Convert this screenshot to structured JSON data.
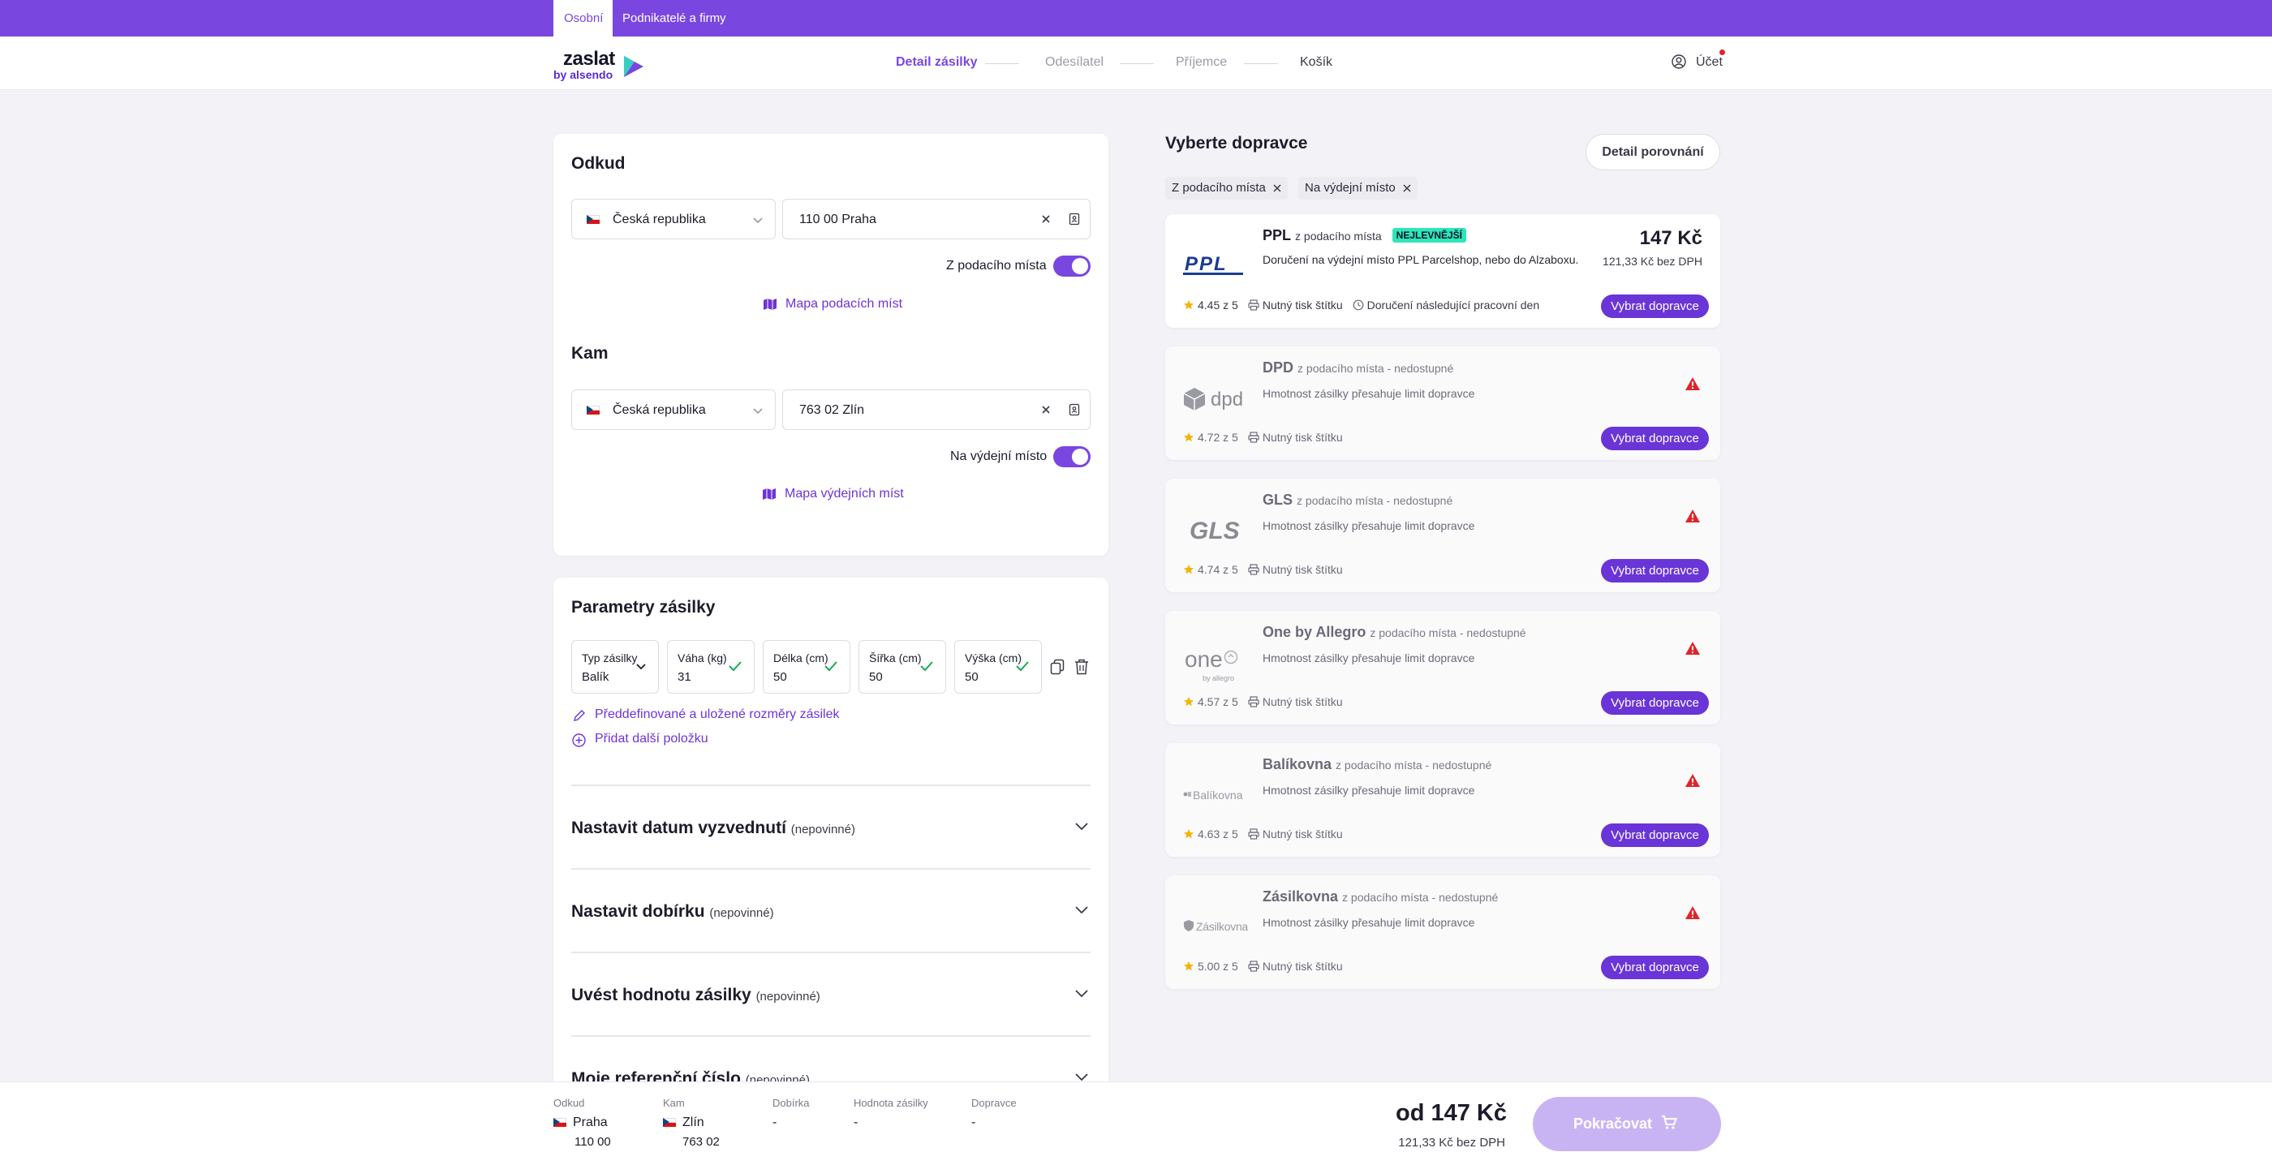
{
  "topbar": {
    "segments": [
      "Osobní",
      "Podnikatelé a firmy"
    ]
  },
  "logo": {
    "word": "zaslat",
    "by": "by alsendo"
  },
  "steps": [
    "Detail zásilky",
    "Odesílatel",
    "Příjemce",
    "Košík"
  ],
  "account": {
    "label": "Účet"
  },
  "from": {
    "title": "Odkud",
    "country": "Česká republika",
    "address": "110 00 Praha",
    "toggle_label": "Z podacího místa",
    "map_link": "Mapa podacích míst"
  },
  "to": {
    "title": "Kam",
    "country": "Česká republika",
    "address": "763 02 Zlín",
    "toggle_label": "Na výdejní místo",
    "map_link": "Mapa výdejních míst"
  },
  "params": {
    "title": "Parametry zásilky",
    "fields": [
      {
        "label": "Typ zásilky",
        "value": "Balík"
      },
      {
        "label": "Váha (kg)",
        "value": "31"
      },
      {
        "label": "Délka (cm)",
        "value": "50"
      },
      {
        "label": "Šířka (cm)",
        "value": "50"
      },
      {
        "label": "Výška (cm)",
        "value": "50"
      }
    ],
    "predefined_link": "Předdefinované a uložené rozměry zásilek",
    "add_link": "Přidat další položku"
  },
  "accordions": [
    {
      "title": "Nastavit datum vyzvednutí",
      "note": "(nepovinné)"
    },
    {
      "title": "Nastavit dobírku",
      "note": "(nepovinné)"
    },
    {
      "title": "Uvést hodnotu zásilky",
      "note": "(nepovinné)"
    },
    {
      "title": "Moje referenční číslo",
      "note": "(nepovinné)"
    }
  ],
  "carriers_panel": {
    "title": "Vyberte dopravce",
    "compare_button": "Detail porovnání",
    "filters": [
      "Z podacího místa",
      "Na výdejní místo"
    ]
  },
  "carriers": [
    {
      "name": "PPL",
      "sub": "z podacího místa",
      "badge": "NEJLEVNĚJŠÍ",
      "desc": "Doručení na výdejní místo PPL Parcelshop, nebo do Alzaboxu.",
      "rating": "4.45 z 5",
      "print": "Nutný tisk štítku",
      "delivery": "Doručení následující pracovní den",
      "price": "147 Kč",
      "price_sub": "121,33 Kč bez DPH",
      "button": "Vybrat dopravce",
      "logo_text": "PPL"
    },
    {
      "name": "DPD",
      "sub": "z podacího místa - nedostupné",
      "desc": "Hmotnost zásilky přesahuje limit dopravce",
      "rating": "4.72 z 5",
      "print": "Nutný tisk štítku",
      "button": "Vybrat dopravce",
      "logo_text": "dpd"
    },
    {
      "name": "GLS",
      "sub": "z podacího místa - nedostupné",
      "desc": "Hmotnost zásilky přesahuje limit dopravce",
      "rating": "4.74 z 5",
      "print": "Nutný tisk štítku",
      "button": "Vybrat dopravce",
      "logo_text": "GLS"
    },
    {
      "name": "One by Allegro",
      "sub": "z podacího místa - nedostupné",
      "desc": "Hmotnost zásilky přesahuje limit dopravce",
      "rating": "4.57 z 5",
      "print": "Nutný tisk štítku",
      "button": "Vybrat dopravce",
      "logo_text": "one",
      "logo_sub": "by allegro"
    },
    {
      "name": "Balíkovna",
      "sub": "z podacího místa - nedostupné",
      "desc": "Hmotnost zásilky přesahuje limit dopravce",
      "rating": "4.63 z 5",
      "print": "Nutný tisk štítku",
      "button": "Vybrat dopravce",
      "logo_text": "Balíkovna"
    },
    {
      "name": "Zásilkovna",
      "sub": "z podacího místa - nedostupné",
      "desc": "Hmotnost zásilky přesahuje limit dopravce",
      "rating": "5.00 z 5",
      "print": "Nutný tisk štítku",
      "button": "Vybrat dopravce",
      "logo_text": "Zásilkovna"
    }
  ],
  "footer": {
    "from_label": "Odkud",
    "from_city": "Praha",
    "from_zip": "110 00",
    "to_label": "Kam",
    "to_city": "Zlín",
    "to_zip": "763 02",
    "cod_label": "Dobírka",
    "cod_value": "-",
    "value_label": "Hodnota zásilky",
    "value_value": "-",
    "carrier_label": "Dopravce",
    "carrier_value": "-",
    "price": "od 147 Kč",
    "price_sub": "121,33 Kč bez DPH",
    "continue": "Pokračovat"
  },
  "colors": {
    "accent": "#7a46e0",
    "button": "#6a35d6",
    "badge": "#2ee6b8",
    "warning": "#e0242b",
    "star": "#f5b400"
  }
}
